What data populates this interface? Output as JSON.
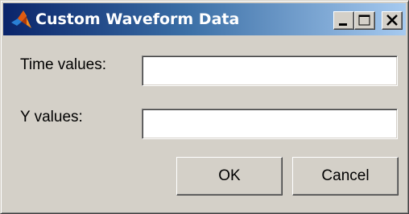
{
  "window": {
    "title": "Custom Waveform Data",
    "icon": "matlab-logo-icon",
    "controls": [
      "minimize-icon",
      "maximize-icon",
      "close-icon"
    ]
  },
  "form": {
    "time_label": "Time values:",
    "time_value": "",
    "y_label": "Y values:",
    "y_value": ""
  },
  "buttons": {
    "ok_label": "OK",
    "cancel_label": "Cancel"
  },
  "colors": {
    "titlebar_start": "#0a246a",
    "titlebar_end": "#a6caf0",
    "face": "#d4d0c8"
  }
}
